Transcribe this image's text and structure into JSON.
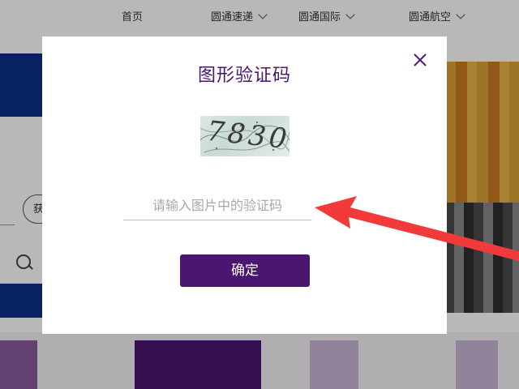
{
  "nav": {
    "items": [
      {
        "label": "首页",
        "has_dropdown": false
      },
      {
        "label": "圆通速递",
        "has_dropdown": true
      },
      {
        "label": "圆通国际",
        "has_dropdown": true
      },
      {
        "label": "圆通航空",
        "has_dropdown": true
      }
    ]
  },
  "background": {
    "pill_label": "获"
  },
  "modal": {
    "title": "图形验证码",
    "captcha_text": "7830",
    "input": {
      "value": "",
      "placeholder": "请输入图片中的验证码"
    },
    "confirm_label": "确定"
  },
  "colors": {
    "accent": "#4a1670",
    "brand_blue": "#0b2f87",
    "annotation_arrow": "#f23a3a"
  }
}
